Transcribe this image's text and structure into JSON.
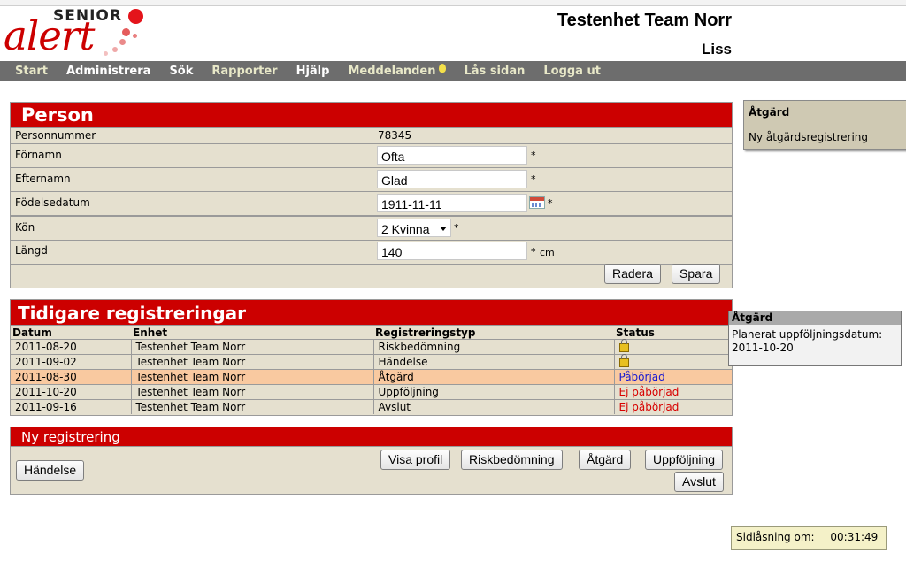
{
  "logo": {
    "top": "SENIOR",
    "main": "alert"
  },
  "header": {
    "unit_title": "Testenhet Team Norr",
    "user": "Liss"
  },
  "nav": [
    {
      "label": "Start",
      "style": "normal"
    },
    {
      "label": "Administrera",
      "style": "white"
    },
    {
      "label": "Sök",
      "style": "white"
    },
    {
      "label": "Rapporter",
      "style": "normal"
    },
    {
      "label": "Hjälp",
      "style": "white"
    },
    {
      "label": "Meddelanden",
      "style": "normal"
    },
    {
      "label": "Lås sidan",
      "style": "normal"
    },
    {
      "label": "Logga ut",
      "style": "normal"
    }
  ],
  "person": {
    "title": "Person",
    "personnummer_label": "Personnummer",
    "personnummer_value": "78345",
    "fornamn_label": "Förnamn",
    "fornamn_value": "Ofta",
    "efternamn_label": "Efternamn",
    "efternamn_value": "Glad",
    "fodelsedatum_label": "Födelsedatum",
    "fodelsedatum_value": "1911-11-11",
    "kon_label": "Kön",
    "kon_value": "2 Kvinna",
    "langd_label": "Längd",
    "langd_value": "140",
    "langd_unit": "cm",
    "required_mark": "*",
    "delete_label": "Radera",
    "save_label": "Spara"
  },
  "history": {
    "title": "Tidigare registreringar",
    "columns": [
      "Datum",
      "Enhet",
      "Registreringstyp",
      "Status"
    ],
    "rows": [
      {
        "date": "2011-08-20",
        "unit": "Testenhet Team Norr",
        "type": "Riskbedömning",
        "status": "",
        "status_kind": "lock"
      },
      {
        "date": "2011-09-02",
        "unit": "Testenhet Team Norr",
        "type": "Händelse",
        "status": "",
        "status_kind": "lock"
      },
      {
        "date": "2011-08-30",
        "unit": "Testenhet Team Norr",
        "type": "Åtgärd",
        "status": "Påbörjad",
        "status_kind": "blue",
        "highlighted": true
      },
      {
        "date": "2011-10-20",
        "unit": "Testenhet Team Norr",
        "type": "Uppföljning",
        "status": "Ej påbörjad",
        "status_kind": "red"
      },
      {
        "date": "2011-09-16",
        "unit": "Testenhet Team Norr",
        "type": "Avslut",
        "status": "Ej påbörjad",
        "status_kind": "red"
      }
    ]
  },
  "new_registration": {
    "title": "Ny registrering",
    "handelse_label": "Händelse",
    "visa_profil_label": "Visa profil",
    "riskbedomning_label": "Riskbedömning",
    "atgard_label": "Åtgärd",
    "uppfoljning_label": "Uppföljning",
    "avslut_label": "Avslut"
  },
  "side_box": {
    "title": "Åtgärd",
    "link": "Ny åtgärdsregistrering"
  },
  "tooltip": {
    "title": "Åtgärd",
    "line1": "Planerat uppföljningsdatum:",
    "line2": "2011-10-20"
  },
  "lock_timer": {
    "label": "Sidlåsning om:",
    "value": "00:31:49"
  }
}
